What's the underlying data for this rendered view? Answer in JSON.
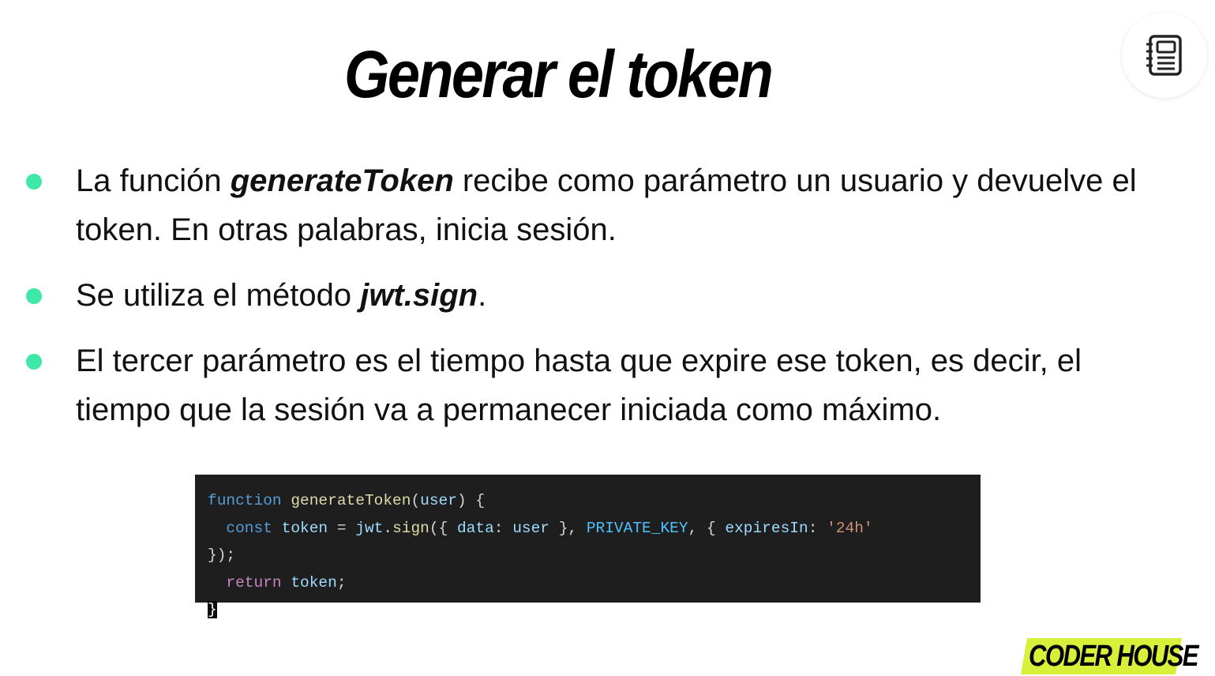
{
  "slide": {
    "title": "Generar el token"
  },
  "bullets": [
    {
      "pre": "La función ",
      "bold": "generateToken",
      "post": " recibe como parámetro un usuario y devuelve el token. En otras palabras, inicia sesión."
    },
    {
      "pre": "Se utiliza el método ",
      "bold": "jwt.sign",
      "post": "."
    },
    {
      "text": "El tercer parámetro es el tiempo hasta que expire ese token, es decir, el tiempo que la sesión va a permanecer iniciada como máximo."
    }
  ],
  "code": {
    "l1_function": "function",
    "l1_name": "generateToken",
    "l1_open": "(",
    "l1_param": "user",
    "l1_close": ") {",
    "l2_indent": "  ",
    "l2_const": "const",
    "l2_token": "token",
    "l2_eq": " = ",
    "l2_jwt": "jwt",
    "l2_dot": ".",
    "l2_sign": "sign",
    "l2_open": "({ ",
    "l2_data": "data",
    "l2_colon": ": ",
    "l2_user": "user",
    "l2_mid": " }, ",
    "l2_key": "PRIVATE_KEY",
    "l2_brace": ", { ",
    "l2_expires": "expiresIn",
    "l2_colon2": ": ",
    "l2_str": "'24h'",
    "l3": "});",
    "l4_indent": "  ",
    "l4_return": "return",
    "l4_token": "token",
    "l4_semi": ";",
    "l5": "}"
  },
  "logo": {
    "text": "CODER HOUSE"
  },
  "colors": {
    "bullet_dot": "#3fe8a8",
    "code_bg": "#1e1e1e",
    "logo_bg": "#d8f03a"
  },
  "icons": {
    "notes": "notebook-icon"
  }
}
